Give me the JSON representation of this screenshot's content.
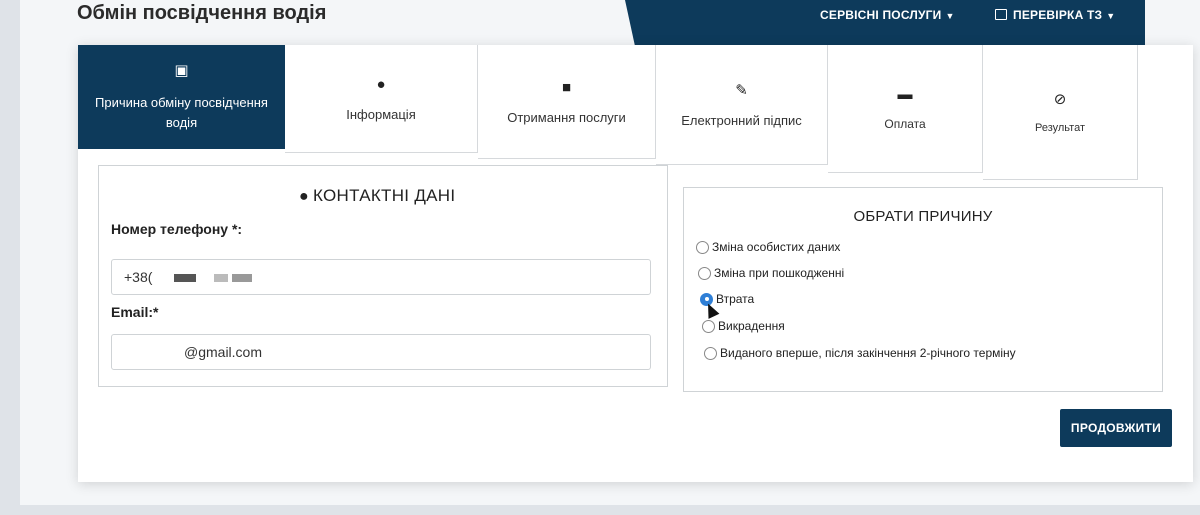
{
  "header": {
    "title": "Обмін посвідчення водія",
    "nav": [
      {
        "label": "СЕРВІСНІ ПОСЛУГИ",
        "icon": "caret-down-icon"
      },
      {
        "label": "ПЕРЕВІРКА ТЗ",
        "icon": "document-icon"
      }
    ]
  },
  "tabs": [
    {
      "label": "Причина обміну посвідчення водія",
      "icon": "clipboard-icon",
      "glyph": "▣",
      "active": true
    },
    {
      "label": "Інформація",
      "icon": "user-icon",
      "glyph": "●",
      "active": false
    },
    {
      "label": "Отримання послуги",
      "icon": "gift-icon",
      "glyph": "■",
      "active": false
    },
    {
      "label": "Електронний підпис",
      "icon": "key-icon",
      "glyph": "✎",
      "active": false
    },
    {
      "label": "Оплата",
      "icon": "money-icon",
      "glyph": "▬",
      "active": false
    },
    {
      "label": "Результат",
      "icon": "check-circle-icon",
      "glyph": "⊘",
      "active": false
    }
  ],
  "contacts": {
    "title": "КОНТАКТНІ ДАНІ",
    "phone_label": "Номер телефону *:",
    "phone_value": "+38(",
    "email_label": "Email:*",
    "email_value": "@gmail.com"
  },
  "reasons": {
    "title": "ОБРАТИ ПРИЧИНУ",
    "options": [
      {
        "label": "Зміна особистих даних",
        "selected": false
      },
      {
        "label": "Зміна при пошкодженні",
        "selected": false
      },
      {
        "label": "Втрата",
        "selected": true
      },
      {
        "label": "Викрадення",
        "selected": false
      },
      {
        "label": "Виданого вперше, після закінчення 2-річного терміну",
        "selected": false
      }
    ]
  },
  "actions": {
    "continue_label": "ПРОДОВЖИТИ"
  },
  "colors": {
    "primary": "#0d3a5b",
    "radio_selected": "#2f7fd6"
  }
}
